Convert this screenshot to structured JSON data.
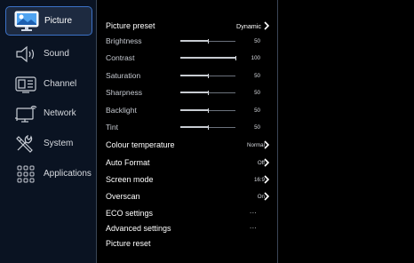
{
  "sidebar": {
    "items": [
      {
        "label": "Picture",
        "icon": "picture-icon",
        "selected": true
      },
      {
        "label": "Sound",
        "icon": "speaker-icon",
        "selected": false
      },
      {
        "label": "Channel",
        "icon": "channel-icon",
        "selected": false
      },
      {
        "label": "Network",
        "icon": "network-icon",
        "selected": false
      },
      {
        "label": "System",
        "icon": "tools-icon",
        "selected": false
      },
      {
        "label": "Applications",
        "icon": "apps-grid-icon",
        "selected": false
      }
    ]
  },
  "picture_menu": {
    "preset": {
      "label": "Picture preset",
      "value": "Dynamic"
    },
    "sliders": [
      {
        "label": "Brightness",
        "value": "50",
        "level": 0.5
      },
      {
        "label": "Contrast",
        "value": "100",
        "level": 1.0
      },
      {
        "label": "Saturation",
        "value": "50",
        "level": 0.5
      },
      {
        "label": "Sharpness",
        "value": "50",
        "level": 0.5
      },
      {
        "label": "Backlight",
        "value": "50",
        "level": 0.5
      },
      {
        "label": "Tint",
        "value": "50",
        "level": 0.5
      }
    ],
    "options": [
      {
        "label": "Colour temperature",
        "value": "Normal"
      },
      {
        "label": "Auto Format",
        "value": "Off"
      },
      {
        "label": "Screen mode",
        "value": "16:9"
      },
      {
        "label": "Overscan",
        "value": "On"
      }
    ],
    "submenus": [
      {
        "label": "ECO settings",
        "value": "..."
      },
      {
        "label": "Advanced settings",
        "value": "..."
      }
    ],
    "reset": {
      "label": "Picture reset"
    }
  },
  "colors": {
    "accent": "#3c72c8",
    "sidebar_bg": "#0a1322",
    "divider": "#3a4556"
  }
}
